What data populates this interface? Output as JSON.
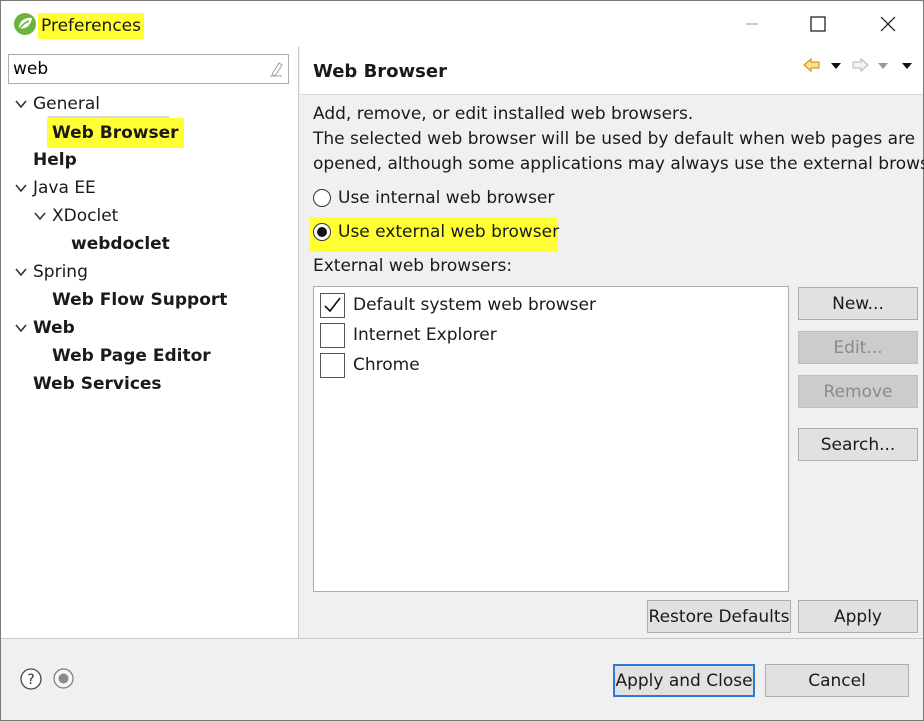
{
  "window": {
    "title": "Preferences",
    "controls": [
      "minimize-icon",
      "maximize-icon",
      "close-icon"
    ],
    "highlight_color": "#ffff33",
    "accent": "#2a7ad6"
  },
  "sidebar": {
    "filter": {
      "value": "web",
      "placeholder": ""
    },
    "items": [
      {
        "label": "General",
        "expanded": true
      },
      {
        "label": "Web Browser",
        "selected": true
      },
      {
        "label": "Help"
      },
      {
        "label": "Java EE",
        "expanded": true
      },
      {
        "label": "XDoclet",
        "expanded": true
      },
      {
        "label": "webdoclet"
      },
      {
        "label": "Spring",
        "expanded": true
      },
      {
        "label": "Web Flow Support"
      },
      {
        "label": "Web",
        "expanded": true
      },
      {
        "label": "Web Page Editor"
      },
      {
        "label": "Web Services"
      }
    ]
  },
  "page": {
    "title": "Web Browser",
    "description": [
      "Add, remove, or edit installed web browsers.",
      "The selected web browser will be used by default when web pages are",
      "opened, although some applications may always use the external browser."
    ],
    "radios": [
      {
        "label": "Use internal web browser",
        "checked": false
      },
      {
        "label": "Use external web browser",
        "checked": true
      }
    ],
    "list_label": "External web browsers:",
    "browsers": [
      {
        "label": "Default system web browser",
        "checked": true
      },
      {
        "label": "Internet Explorer",
        "checked": false
      },
      {
        "label": "Chrome",
        "checked": false
      }
    ],
    "buttons": {
      "new": "New...",
      "edit": "Edit...",
      "remove": "Remove",
      "search": "Search...",
      "restore": "Restore Defaults",
      "apply": "Apply"
    }
  },
  "footer": {
    "apply_close": "Apply and Close",
    "cancel": "Cancel",
    "icons": [
      "help-icon",
      "preferences-import-icon"
    ]
  }
}
